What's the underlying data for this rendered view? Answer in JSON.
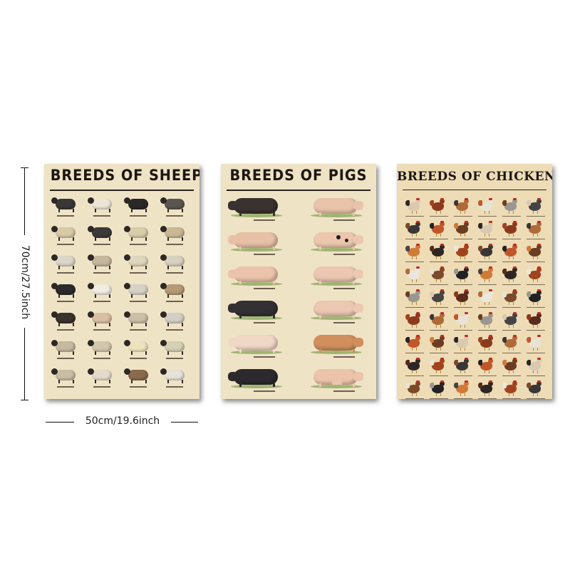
{
  "posters": {
    "sheep": {
      "title": "BREEDS OF SHEEP"
    },
    "pigs": {
      "title": "BREEDS OF PIGS"
    },
    "chicken": {
      "title": "BREEDS OF CHICKEN"
    }
  },
  "dimensions": {
    "height_label": "70cm/27.5inch",
    "width_label": "50cm/19.6inch"
  },
  "colors": {
    "poster_bg": "#efe3c6",
    "title_text": "#1d1712"
  }
}
